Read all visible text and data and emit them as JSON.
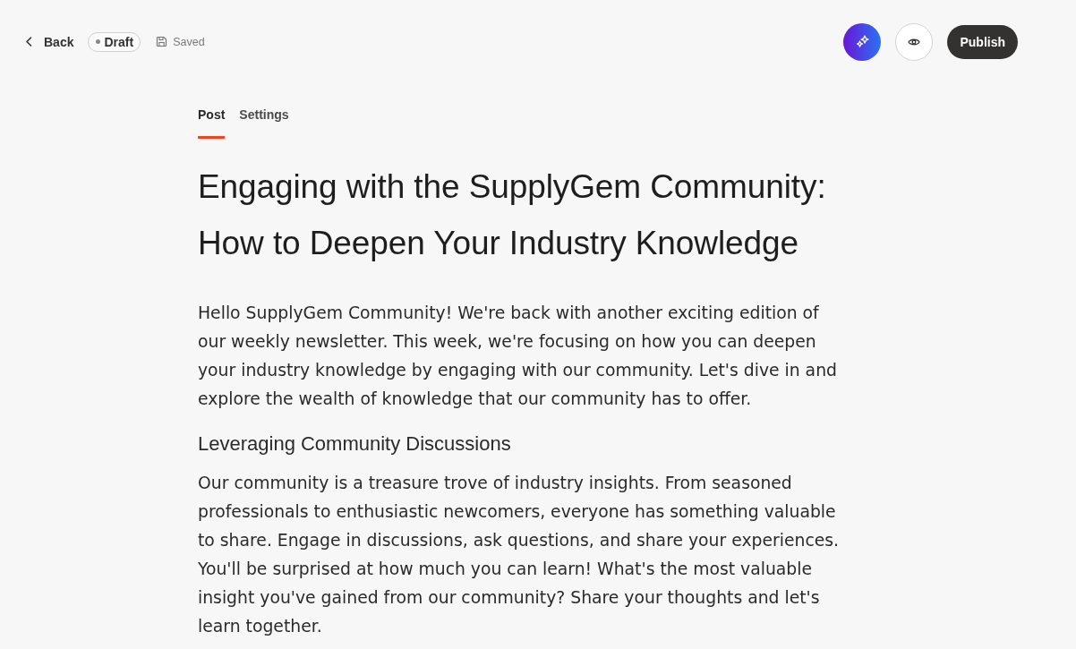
{
  "topbar": {
    "back": "Back",
    "status": {
      "label": "Draft"
    },
    "save_state": "Saved",
    "publish": "Publish"
  },
  "tabs": [
    {
      "label": "Post",
      "selected": true
    },
    {
      "label": "Settings",
      "selected": false
    }
  ],
  "article": {
    "title": "Engaging with the SupplyGem Community: How to Deepen Your Industry Knowledge",
    "blocks": [
      {
        "kind": "paragraph",
        "text": "Hello SupplyGem Community! We're back with another exciting edition of our weekly newsletter. This week, we're focusing on how you can deepen your industry knowledge by engaging with our community. Let's dive in and explore the wealth of knowledge that our community has to offer."
      },
      {
        "kind": "heading",
        "text": "Leveraging Community Discussions"
      },
      {
        "kind": "paragraph",
        "text": "Our community is a treasure trove of industry insights. From seasoned professionals to enthusiastic newcomers, everyone has something valuable to share. Engage in discussions, ask questions, and share your experiences. You'll be surprised at how much you can learn! What's the most valuable insight you've gained from our community? Share your thoughts and let's learn together."
      }
    ]
  }
}
